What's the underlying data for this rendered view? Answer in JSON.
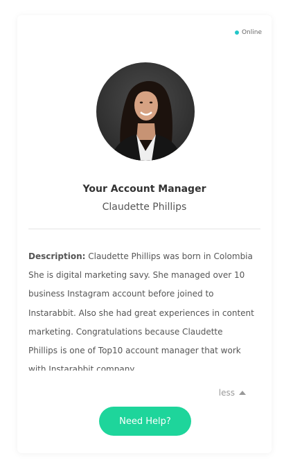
{
  "status": {
    "label": "Online",
    "color": "#23c6c8"
  },
  "manager": {
    "heading": "Your Account Manager",
    "name": "Claudette Phillips"
  },
  "description": {
    "label": "Description:",
    "text": "Claudette Phillips was born in Colombia She is digital marketing savy. She managed over 10 business Instagram account before joined to Instarabbit. Also she had great experiences in content marketing. Congratulations because Claudette Phillips is one of Top10 account manager that work with Instarabbit company"
  },
  "toggle": {
    "label": "less",
    "icon": "caret-up-icon"
  },
  "help_button": {
    "label": "Need Help?",
    "color": "#1ed59b"
  }
}
